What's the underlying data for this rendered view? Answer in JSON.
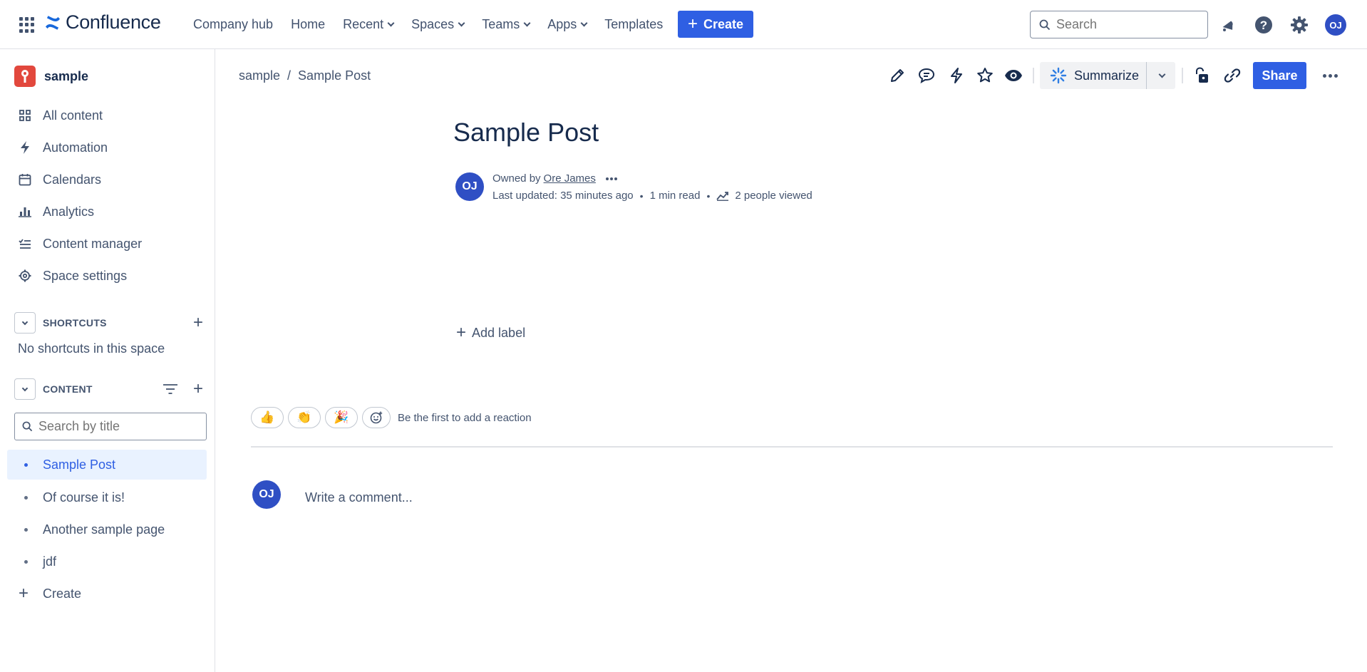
{
  "topnav": {
    "logo_text": "Confluence",
    "items": [
      {
        "label": "Company hub",
        "has_dropdown": false
      },
      {
        "label": "Home",
        "has_dropdown": false
      },
      {
        "label": "Recent",
        "has_dropdown": true
      },
      {
        "label": "Spaces",
        "has_dropdown": true
      },
      {
        "label": "Teams",
        "has_dropdown": true
      },
      {
        "label": "Apps",
        "has_dropdown": true
      },
      {
        "label": "Templates",
        "has_dropdown": false
      }
    ],
    "create_label": "Create",
    "search_placeholder": "Search",
    "user_initials": "OJ"
  },
  "sidebar": {
    "space_name": "sample",
    "nav": [
      {
        "label": "All content",
        "icon": "grid-icon"
      },
      {
        "label": "Automation",
        "icon": "lightning-icon"
      },
      {
        "label": "Calendars",
        "icon": "calendar-icon"
      },
      {
        "label": "Analytics",
        "icon": "bar-chart-icon"
      },
      {
        "label": "Content manager",
        "icon": "checklist-icon"
      },
      {
        "label": "Space settings",
        "icon": "gear-icon"
      }
    ],
    "shortcuts": {
      "title": "SHORTCUTS",
      "empty_text": "No shortcuts in this space"
    },
    "content": {
      "title": "CONTENT",
      "search_placeholder": "Search by title",
      "tree": [
        {
          "label": "Sample Post",
          "active": true
        },
        {
          "label": "Of course it is!",
          "active": false
        },
        {
          "label": "Another sample page",
          "active": false
        },
        {
          "label": "jdf",
          "active": false
        }
      ],
      "create_label": "Create"
    }
  },
  "page": {
    "breadcrumb": [
      "sample",
      "Sample Post"
    ],
    "summarize_label": "Summarize",
    "share_label": "Share",
    "title": "Sample Post",
    "owner_initials": "OJ",
    "owned_by_prefix": "Owned by",
    "owner_name": "Ore James",
    "last_updated": "Last updated: 35 minutes ago",
    "read_time": "1 min read",
    "views": "2 people viewed",
    "add_label": "Add label",
    "reactions": [
      "👍",
      "👏",
      "🎉"
    ],
    "reaction_prompt": "Be the first to add a reaction",
    "commenter_initials": "OJ",
    "comment_placeholder": "Write a comment..."
  },
  "colors": {
    "accent": "#2f5fe3",
    "avatar": "#2f4fc4",
    "text": "#172b4d",
    "subtle_text": "#44546f",
    "space_icon": "#e2483d"
  }
}
